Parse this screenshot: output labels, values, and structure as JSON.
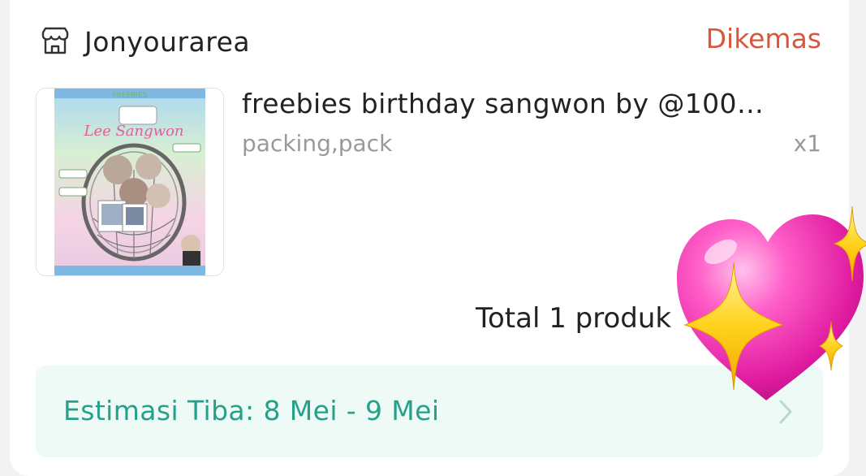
{
  "shop": {
    "icon": "store-icon",
    "name": "Jonyourarea",
    "status": "Dikemas",
    "status_color": "#d9563a"
  },
  "product": {
    "thumbnail_icon": "product-thumbnail",
    "title": "freebies birthday sangwon by @100…",
    "variant": "packing,pack",
    "quantity": "x1"
  },
  "summary": {
    "total_label": "Total 1 produk"
  },
  "delivery": {
    "eta_label": "Estimasi Tiba: 8 Mei - 9 Mei",
    "eta_color": "#26a08a",
    "chevron_icon": "chevron-right-icon"
  },
  "sticker": {
    "icon": "sparkling-heart-icon"
  }
}
